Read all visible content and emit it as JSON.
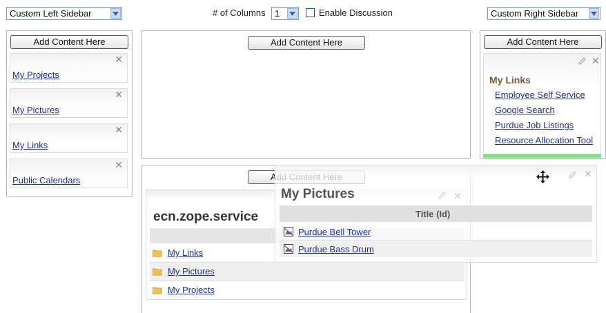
{
  "controls": {
    "left_sidebar_select": "Custom Left Sidebar",
    "columns_label": "# of Columns",
    "columns_value": "1",
    "discussion_label": "Enable Discussion",
    "right_sidebar_select": "Custom Right Sidebar"
  },
  "left_sidebar": {
    "add_label": "Add Content Here",
    "portlets": [
      {
        "title": "My Projects"
      },
      {
        "title": "My Pictures"
      },
      {
        "title": "My Links"
      },
      {
        "title": "Public Calendars"
      }
    ]
  },
  "main": {
    "top_add_label": "Add Content Here",
    "bottom_add_label": "Add Content Here",
    "folder_portlet": {
      "title": "ecn.zope.service",
      "rows": [
        "My Links",
        "My Pictures",
        "My Projects"
      ]
    },
    "drag_portlet": {
      "title": "My Pictures",
      "column_header": "Title (Id)",
      "items": [
        "Purdue Bell Tower",
        "Purdue Bass Drum"
      ]
    }
  },
  "right_sidebar": {
    "add_label": "Add Content Here",
    "links_title": "My Links",
    "links": [
      "Employee Self Service",
      "Google Search",
      "Purdue Job Listings",
      "Resource Allocation Tool"
    ]
  },
  "colors": {
    "link": "#1a2ea8",
    "title_brown": "#7a5b33",
    "accent_green": "#7ee67e"
  }
}
